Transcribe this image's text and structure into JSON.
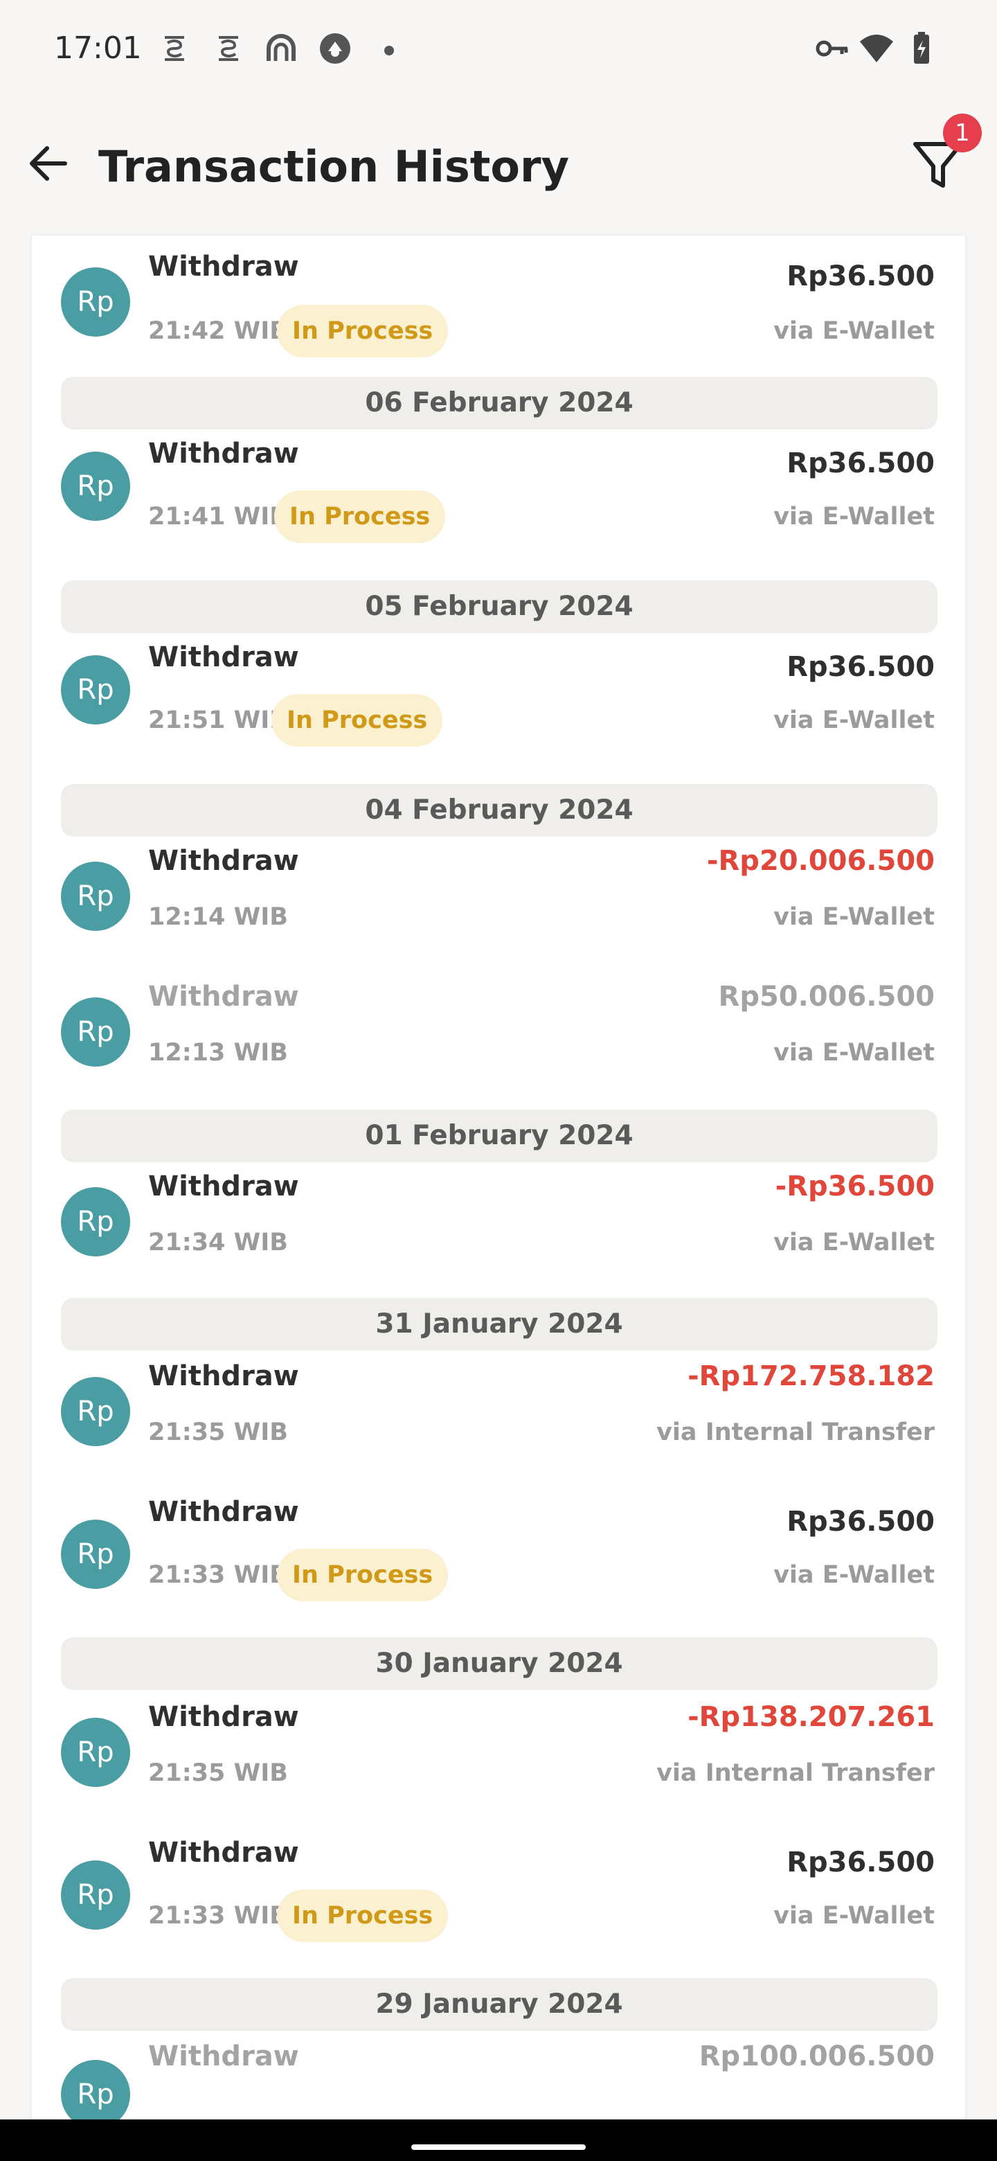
{
  "status_bar": {
    "time": "17:01",
    "icons": [
      "s-notification-icon",
      "s-notification-icon",
      "app-notification-icon",
      "app-notification-icon",
      "more-dot-icon",
      "vpn-key-icon",
      "wifi-icon",
      "battery-charging-icon"
    ]
  },
  "header": {
    "title": "Transaction History",
    "back_icon": "arrow-left-icon",
    "filter_icon": "filter-icon",
    "filter_badge": "1"
  },
  "colors": {
    "avatar": "#4a9ea3",
    "negative": "#e0463a",
    "status_bg": "#fbf0cf",
    "status_text": "#d09a18",
    "badge": "#e53e4c"
  },
  "avatar_text": "Rp",
  "transactions": [
    {
      "type": "Withdraw",
      "time": "21:42 WIB",
      "status": "In Process",
      "amount": "Rp36.500",
      "method": "via E-Wallet"
    },
    {
      "type": "Withdraw",
      "time": "21:41 WIB",
      "status": "In Process",
      "amount": "Rp36.500",
      "method": "via E-Wallet"
    },
    {
      "type": "Withdraw",
      "time": "21:51 WIB",
      "status": "In Process",
      "amount": "Rp36.500",
      "method": "via E-Wallet"
    },
    {
      "type": "Withdraw",
      "time": "12:14 WIB",
      "status": "",
      "amount": "-Rp20.006.500",
      "method": "via E-Wallet"
    },
    {
      "type": "Withdraw",
      "time": "12:13 WIB",
      "status": "",
      "amount": "Rp50.006.500",
      "method": "via E-Wallet"
    },
    {
      "type": "Withdraw",
      "time": "21:34 WIB",
      "status": "",
      "amount": "-Rp36.500",
      "method": "via E-Wallet"
    },
    {
      "type": "Withdraw",
      "time": "21:35 WIB",
      "status": "",
      "amount": "-Rp172.758.182",
      "method": "via Internal Transfer"
    },
    {
      "type": "Withdraw",
      "time": "21:33 WIB",
      "status": "In Process",
      "amount": "Rp36.500",
      "method": "via E-Wallet"
    },
    {
      "type": "Withdraw",
      "time": "21:35 WIB",
      "status": "",
      "amount": "-Rp138.207.261",
      "method": "via Internal Transfer"
    },
    {
      "type": "Withdraw",
      "time": "21:33 WIB",
      "status": "In Process",
      "amount": "Rp36.500",
      "method": "via E-Wallet"
    },
    {
      "type": "Withdraw",
      "time": "",
      "status": "",
      "amount": "Rp100.006.500",
      "method": ""
    }
  ],
  "date_headers": [
    "06 February 2024",
    "05 February 2024",
    "04 February 2024",
    "01 February 2024",
    "31 January 2024",
    "30 January 2024",
    "29 January 2024"
  ]
}
